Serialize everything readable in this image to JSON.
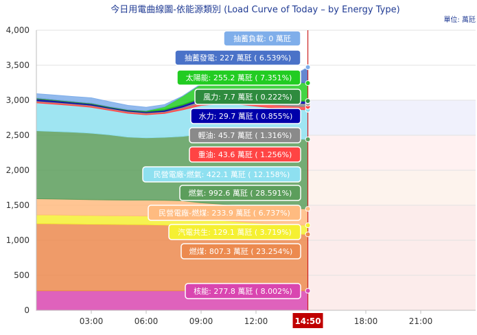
{
  "chart_data": {
    "type": "area",
    "title": "今日用電曲線圖-依能源類別 (Load Curve of Today – by Energy Type)",
    "unit_label": "單位: 萬瓩",
    "ylim": [
      0,
      4000
    ],
    "y_ticks": [
      "0",
      "500",
      "1,000",
      "1,500",
      "2,000",
      "2,500",
      "3,000",
      "3,500",
      "4,000"
    ],
    "y_tick_values": [
      0,
      500,
      1000,
      1500,
      2000,
      2500,
      3000,
      3500,
      4000
    ],
    "x_ticks": [
      "03:00",
      "06:00",
      "09:00",
      "12:00",
      "18:00",
      "21:00"
    ],
    "x_tick_hours": [
      3,
      6,
      9,
      12,
      18,
      21
    ],
    "current_time": "14:50",
    "current_time_hours": 14.8333,
    "stack_order": [
      "核能",
      "燃煤",
      "汽電共生",
      "民營電廠-燃煤",
      "燃氣",
      "民營電廠-燃氣",
      "重油",
      "輕油",
      "水力",
      "風力",
      "太陽能",
      "抽蓄發電",
      "抽蓄負載"
    ],
    "x_hours": [
      0,
      1,
      2,
      3,
      4,
      5,
      6,
      7,
      8,
      9,
      10,
      11,
      12,
      13,
      14,
      14.83
    ],
    "series": [
      {
        "name": "核能",
        "color": "#d946b0",
        "label": "核能: 277.8 萬瓩 ( 8.002%)",
        "value": 277.8,
        "values": [
          278,
          278,
          278,
          278,
          278,
          278,
          278,
          278,
          278,
          278,
          278,
          278,
          278,
          278,
          278,
          277.8
        ]
      },
      {
        "name": "燃煤",
        "color": "#ec8a4f",
        "label": "燃煤: 807.3 萬瓩 ( 23.254%)",
        "value": 807.3,
        "values": [
          960,
          958,
          955,
          952,
          950,
          948,
          945,
          940,
          930,
          900,
          880,
          860,
          840,
          825,
          815,
          807.3
        ]
      },
      {
        "name": "汽電共生",
        "color": "#f5f032",
        "label": "汽電共生: 129.1 萬瓩 ( 3.719%)",
        "value": 129.1,
        "values": [
          125,
          125,
          124,
          124,
          123,
          123,
          124,
          125,
          126,
          127,
          128,
          128,
          129,
          129,
          129,
          129.1
        ]
      },
      {
        "name": "民營電廠-燃煤",
        "color": "#ffbb80",
        "label": "民營電廠-燃煤: 233.9 萬瓩 ( 6.737%)",
        "value": 233.9,
        "values": [
          230,
          228,
          227,
          226,
          225,
          225,
          226,
          228,
          230,
          231,
          232,
          233,
          233,
          234,
          234,
          233.9
        ]
      },
      {
        "name": "燃氣",
        "color": "#5c9e5c",
        "label": "燃氣: 992.6 萬瓩 ( 28.591%)",
        "value": 992.6,
        "values": [
          970,
          965,
          960,
          950,
          930,
          900,
          890,
          900,
          920,
          980,
          1010,
          1020,
          1010,
          1000,
          995,
          992.6
        ]
      },
      {
        "name": "民營電廠-燃氣",
        "color": "#8ee0f0",
        "label": "民營電廠-燃氣: 422.1 萬瓩 ( 12.158%)",
        "value": 422.1,
        "values": [
          400,
          390,
          380,
          370,
          350,
          340,
          330,
          340,
          380,
          410,
          420,
          425,
          425,
          423,
          422,
          422.1
        ]
      },
      {
        "name": "重油",
        "color": "#ff4444",
        "label": "重油: 43.6 萬瓩 ( 1.256%)",
        "value": 43.6,
        "values": [
          20,
          20,
          20,
          20,
          20,
          20,
          20,
          20,
          25,
          35,
          40,
          42,
          43,
          43,
          43,
          43.6
        ]
      },
      {
        "name": "輕油",
        "color": "#8a8a8a",
        "label": "輕油: 45.7 萬瓩 ( 1.316%)",
        "value": 45.7,
        "values": [
          10,
          10,
          10,
          10,
          10,
          10,
          10,
          10,
          15,
          30,
          40,
          45,
          46,
          46,
          46,
          45.7
        ]
      },
      {
        "name": "水力",
        "color": "#0000aa",
        "label": "水力: 29.7 萬瓩 ( 0.855%)",
        "value": 29.7,
        "values": [
          25,
          20,
          15,
          15,
          10,
          10,
          10,
          15,
          25,
          30,
          30,
          30,
          30,
          30,
          30,
          29.7
        ]
      },
      {
        "name": "風力",
        "color": "#2e8b3e",
        "label": "風力: 7.7 萬瓩 ( 0.222%)",
        "value": 7.7,
        "values": [
          15,
          15,
          14,
          14,
          13,
          13,
          12,
          12,
          11,
          10,
          10,
          9,
          9,
          8,
          8,
          7.7
        ]
      },
      {
        "name": "太陽能",
        "color": "#22cc22",
        "label": "太陽能: 255.2 萬瓩 ( 7.351%)",
        "value": 255.2,
        "values": [
          0,
          0,
          0,
          0,
          0,
          0,
          5,
          40,
          120,
          200,
          250,
          280,
          290,
          280,
          265,
          255.2
        ]
      },
      {
        "name": "抽蓄發電",
        "color": "#4a72c8",
        "label": "抽蓄發電: 227 萬瓩 ( 6.539%)",
        "value": 227,
        "values": [
          0,
          0,
          0,
          0,
          0,
          0,
          0,
          0,
          0,
          0,
          0,
          0,
          0,
          0,
          80,
          227
        ]
      },
      {
        "name": "抽蓄負載",
        "color": "#7faeea",
        "label": "抽蓄負載: 0 萬瓩",
        "value": 0,
        "values": [
          60,
          65,
          70,
          75,
          70,
          60,
          50,
          30,
          0,
          0,
          0,
          0,
          0,
          0,
          0,
          0
        ]
      }
    ]
  }
}
